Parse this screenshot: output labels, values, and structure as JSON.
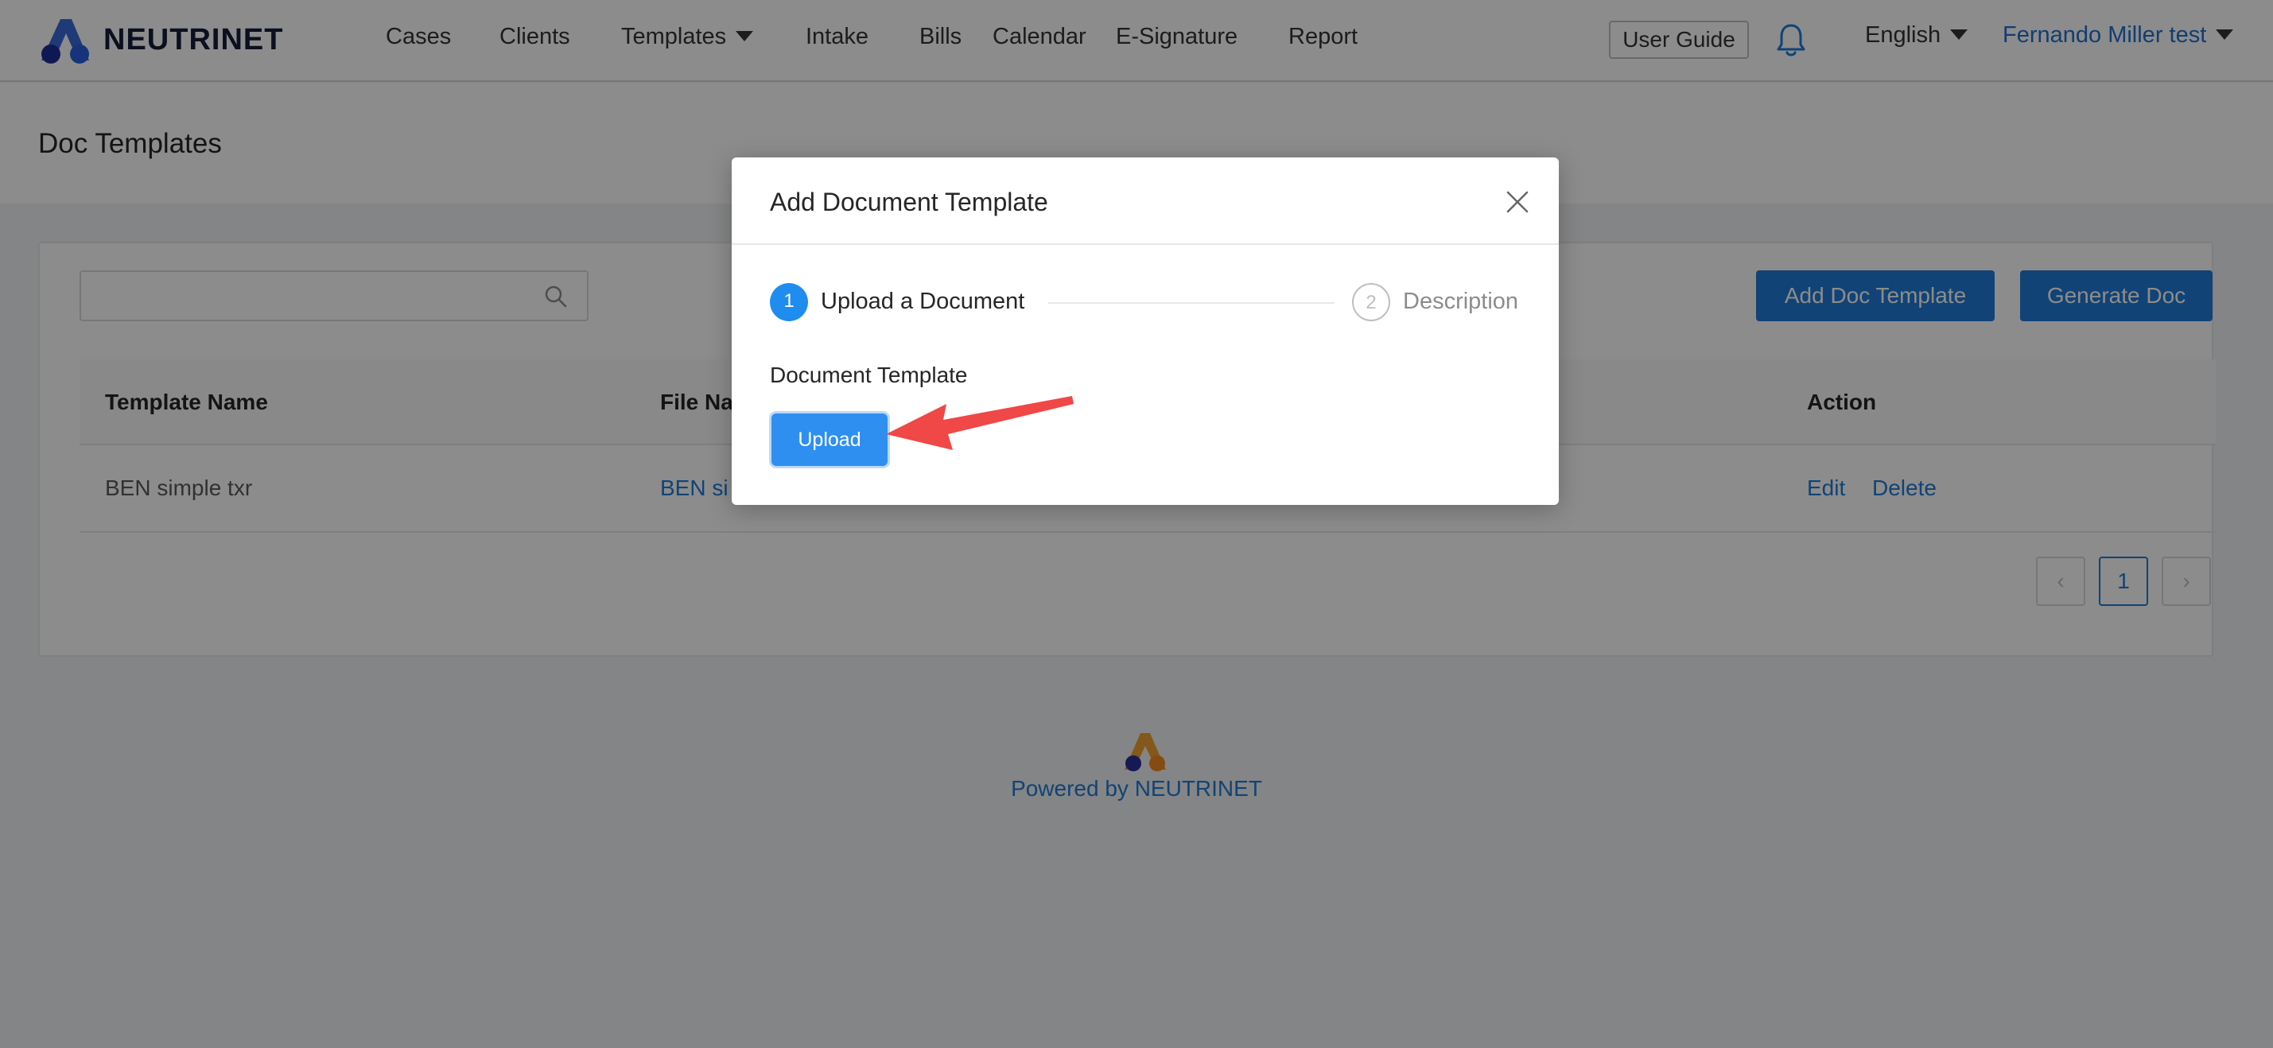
{
  "brand": {
    "name": "NEUTRINET"
  },
  "nav": {
    "cases": "Cases",
    "clients": "Clients",
    "templates": "Templates",
    "intake": "Intake",
    "bills": "Bills",
    "calendar": "Calendar",
    "esignature": "E-Signature",
    "report": "Report"
  },
  "header": {
    "user_guide": "User Guide",
    "language": "English",
    "user_name": "Fernando Miller test"
  },
  "page": {
    "title": "Doc Templates",
    "add_button": "Add Doc Template",
    "generate_button": "Generate Doc",
    "search_placeholder": ""
  },
  "table": {
    "columns": [
      "Template Name",
      "File Na",
      "Action"
    ],
    "rows": [
      {
        "template_name": "BEN simple txr",
        "file_name": "BEN si",
        "edit": "Edit",
        "delete": "Delete"
      }
    ]
  },
  "pagination": {
    "current": "1",
    "prev": "‹",
    "next": "›"
  },
  "footer": {
    "text": "Powered by NEUTRINET"
  },
  "modal": {
    "title": "Add Document Template",
    "steps": [
      {
        "number": "1",
        "label": "Upload a Document",
        "status": "active"
      },
      {
        "number": "2",
        "label": "Description",
        "status": "wait"
      }
    ],
    "field_label": "Document Template",
    "upload_button": "Upload"
  },
  "colors": {
    "primary": "#1f7ad8",
    "step_active": "#1f8cf0",
    "annotation_arrow": "#f04747",
    "mask": "rgba(0,0,0,0.45)"
  }
}
